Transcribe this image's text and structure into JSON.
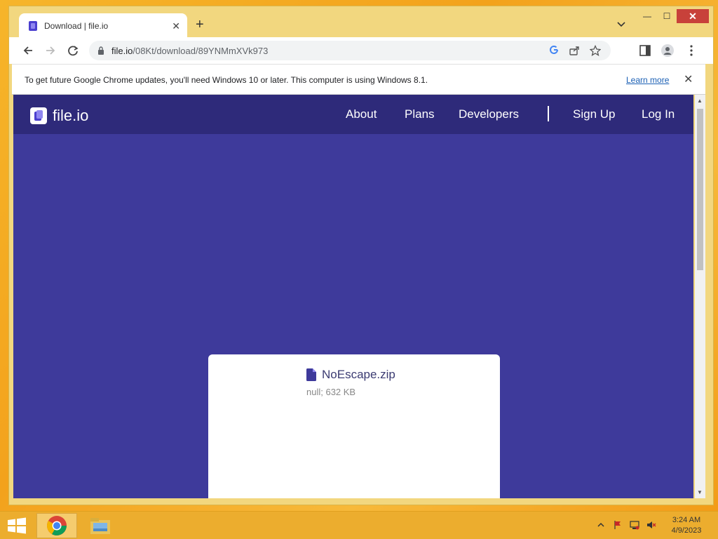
{
  "browser": {
    "tab_title": "Download | file.io",
    "url_host": "file.io",
    "url_path": "/08Kt/download/89YNMmXVk973"
  },
  "infobar": {
    "message": "To get future Google Chrome updates, you'll need Windows 10 or later. This computer is using Windows 8.1.",
    "learn_more": "Learn more"
  },
  "site": {
    "logo": "file.io",
    "nav": [
      "About",
      "Plans",
      "Developers",
      "Sign Up",
      "Log In"
    ]
  },
  "file": {
    "name": "NoEscape.zip",
    "meta": "null; 632 KB"
  },
  "taskbar": {
    "time": "3:24 AM",
    "date": "4/9/2023"
  },
  "colors": {
    "page_bg": "#3e3a9b",
    "header_bg": "#2e2a7a",
    "accent": "#5b4fd6"
  }
}
